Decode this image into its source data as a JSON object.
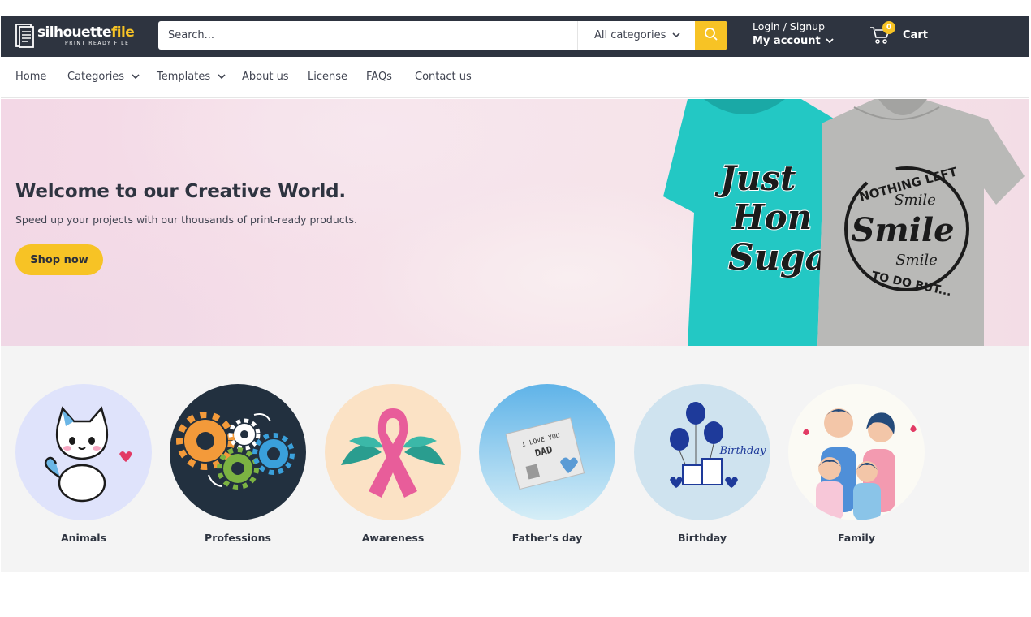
{
  "brand": {
    "logo_word_1": "silhouette",
    "logo_word_2": "file",
    "logo_tagline": "PRINT READY FILE",
    "accent_color": "#f7c325",
    "header_color": "#2e3440"
  },
  "header": {
    "search_placeholder": "Search...",
    "category_select": "All categories",
    "search_icon": "search-icon",
    "login_label": "Login / Signup",
    "account_label": "My account",
    "cart_count": "0",
    "cart_label": "Cart"
  },
  "nav": {
    "items": [
      {
        "label": "Home",
        "has_dropdown": false
      },
      {
        "label": "Categories",
        "has_dropdown": true
      },
      {
        "label": "Templates",
        "has_dropdown": true
      },
      {
        "label": "About us",
        "has_dropdown": false
      },
      {
        "label": "License",
        "has_dropdown": false
      },
      {
        "label": "FAQs",
        "has_dropdown": false
      },
      {
        "label": "Contact us",
        "has_dropdown": false
      }
    ]
  },
  "hero": {
    "title": "Welcome to our Creative World.",
    "subtitle": "Speed up your projects with our thousands of print-ready products.",
    "cta_label": "Shop now",
    "tshirt_1_print": [
      "Just",
      "Hon",
      "Suga"
    ],
    "tshirt_2_print": [
      "NOTHING LEFT",
      "Smile",
      "Smile",
      "Smile",
      "TO DO BUT..."
    ]
  },
  "categories": [
    {
      "label": "Animals",
      "icon": "cat-icon"
    },
    {
      "label": "Professions",
      "icon": "gears-icon"
    },
    {
      "label": "Awareness",
      "icon": "ribbon-icon"
    },
    {
      "label": "Father's day",
      "icon": "card-icon",
      "card_text": [
        "I LOVE YOU",
        "DAD"
      ]
    },
    {
      "label": "Birthday",
      "icon": "balloons-icon",
      "card_text": [
        "Birthday"
      ]
    },
    {
      "label": "Family",
      "icon": "family-icon"
    }
  ]
}
